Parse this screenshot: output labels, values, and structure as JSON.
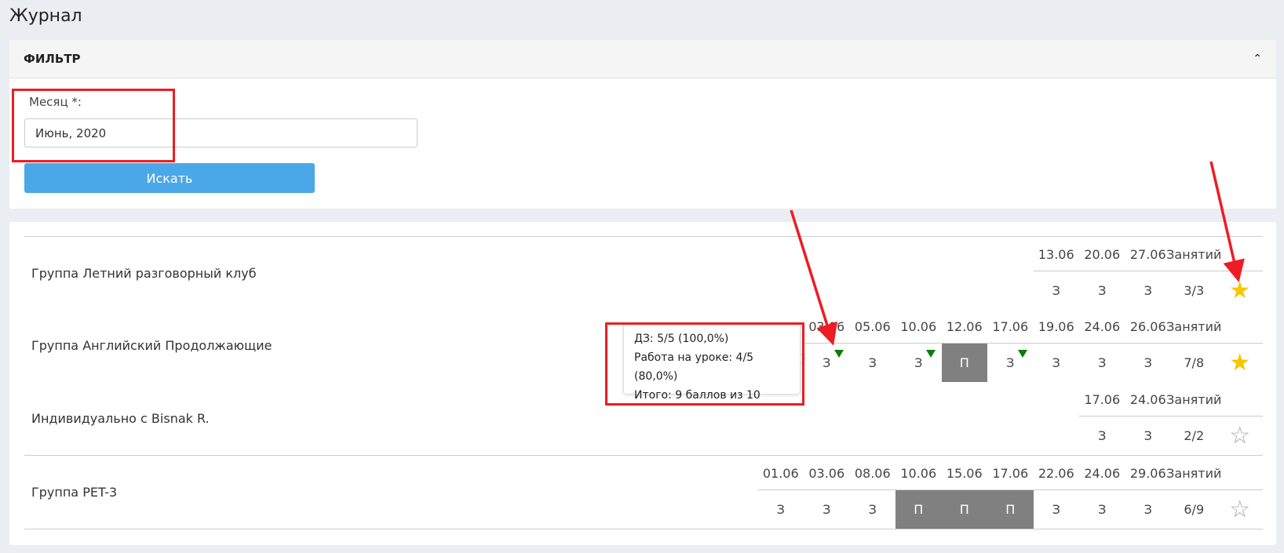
{
  "page": {
    "title": "Журнал"
  },
  "filter": {
    "title": "ФИЛЬТР",
    "month_label": "Месяц *:",
    "month_value": "Июнь, 2020",
    "search_label": "Искать"
  },
  "groups": [
    {
      "name": "Группа Летний разговорный клуб",
      "dates": [
        "13.06",
        "20.06",
        "27.06"
      ],
      "marks": [
        "З",
        "З",
        "З"
      ],
      "total_header": "Занятий",
      "total": "3/3",
      "star": "filled"
    },
    {
      "name": "Группа Английский Продолжающие",
      "dates": [
        "03.06",
        "05.06",
        "10.06",
        "12.06",
        "17.06",
        "19.06",
        "24.06",
        "26.06"
      ],
      "marks": [
        "З",
        "З",
        "З",
        "П",
        "З",
        "З",
        "З",
        "З"
      ],
      "total_header": "Занятий",
      "total": "7/8",
      "star": "filled"
    },
    {
      "name": "Индивидуально с Bisnak R.",
      "dates": [
        "17.06",
        "24.06"
      ],
      "marks": [
        "З",
        "З"
      ],
      "total_header": "Занятий",
      "total": "2/2",
      "star": "empty"
    },
    {
      "name": "Группа PET-3",
      "dates": [
        "01.06",
        "03.06",
        "08.06",
        "10.06",
        "15.06",
        "17.06",
        "22.06",
        "24.06",
        "29.06"
      ],
      "marks": [
        "З",
        "З",
        "З",
        "П",
        "П",
        "П",
        "З",
        "З",
        "З"
      ],
      "total_header": "Занятий",
      "total": "6/9",
      "star": "empty"
    }
  ],
  "tooltip": {
    "line1": "ДЗ: 5/5 (100,0%)",
    "line2": "Работа на уроке: 4/5 (80,0%)",
    "line3": "Итого: 9 баллов из 10"
  },
  "colors": {
    "accent": "#4aa8e8",
    "absent": "#808080",
    "star": "#f7c600",
    "annotation": "#ee1c24",
    "homework_marker": "#0a7d0a"
  }
}
